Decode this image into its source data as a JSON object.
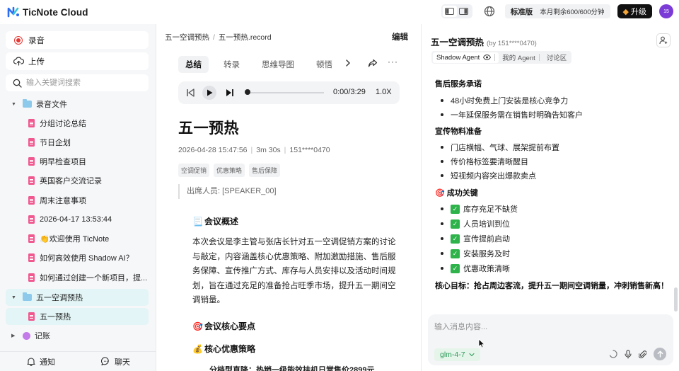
{
  "app": {
    "title": "TicNote Cloud",
    "plan": "标准版",
    "quota": "本月剩余600/600分钟",
    "upgrade_label": "升级",
    "avatar_initials": "15",
    "avatar_color": "#7a3bd6"
  },
  "sidebar": {
    "record_label": "录音",
    "upload_label": "上传",
    "search_placeholder": "输入关键词搜索",
    "folders": [
      {
        "name": "录音文件",
        "items": [
          "分组讨论总结",
          "节日企划",
          "明早检查项目",
          "英国客户交流记录",
          "周末注意事项",
          "2026-04-17 13:53:44",
          "👏欢迎使用 TicNote",
          "如何高效使用 Shadow AI？",
          "如何通过创建一个新项目，提..."
        ]
      },
      {
        "name": "五一空调预热",
        "items": [
          "五一预热"
        ]
      },
      {
        "name": "记账",
        "items": []
      }
    ],
    "bottom": {
      "notify_label": "通知",
      "chat_label": "聊天"
    }
  },
  "document": {
    "breadcrumb": [
      "五一空调预热",
      "五一预热.record"
    ],
    "edit_label": "编辑",
    "tabs": [
      "总结",
      "转录",
      "思维导图",
      "顿悟"
    ],
    "active_tab": 0,
    "player": {
      "time": "0:00/3:29",
      "speed": "1.0X",
      "progress": 0
    },
    "title": "五一预热",
    "meta": [
      "2026-04-28 15:47:56",
      "3m 30s",
      "151****0470"
    ],
    "tags": [
      "空调促销",
      "优惠策略",
      "售后保障"
    ],
    "attendees": "出席人员: [SPEAKER_00]",
    "sections": [
      {
        "emoji": "📃",
        "title": "会议概述"
      },
      {
        "emoji": "🎯",
        "title": "会议核心要点"
      },
      {
        "emoji": "💰",
        "title": "核心优惠策略"
      }
    ],
    "overview": "本次会议是李主管与张店长针对五一空调促销方案的讨论与敲定，内容涵盖核心优惠策略、附加激励措施、售后服务保障、宣传推广方式、库存与人员安排以及活动时间规划，旨在通过充足的准备抢占旺季市场，提升五一期间空调销量。",
    "cut_line": "分档型直降：热销一级能效挂机日常售价2899元"
  },
  "agent": {
    "title": "五一空调预热",
    "subtitle": "(by 151****0470)",
    "tabs": [
      "Shadow Agent",
      "我的 Agent",
      "讨论区"
    ],
    "active_tab": 0,
    "sections": [
      {
        "title": "售后服务承诺",
        "items": [
          "48小时免费上门安装是核心竞争力",
          "一年延保服务需在销售时明确告知客户"
        ]
      },
      {
        "title": "宣传物料准备",
        "items": [
          "门店横幅、气球、展架提前布置",
          "传价格标签要清晰醒目",
          "短视频内容突出爆款卖点"
        ]
      }
    ],
    "success": {
      "title": "🎯 成功关键",
      "items": [
        "库存充足不缺货",
        "人员培训到位",
        "宣传提前启动",
        "安装服务及时",
        "优惠政策清晰"
      ]
    },
    "goal_label": "核心目标：",
    "goal_text": "抢占周边客流，提升五一期间空调销量，冲刺销售新高！",
    "input_placeholder": "输入消息内容...",
    "model": "glm-4-7"
  },
  "colors": {
    "accent_teal": "#e3f5f6",
    "check_green": "#2db34a",
    "doc_pink": "#f0588f",
    "folder_blue": "#8cc9ea",
    "record_red": "#e53935"
  }
}
